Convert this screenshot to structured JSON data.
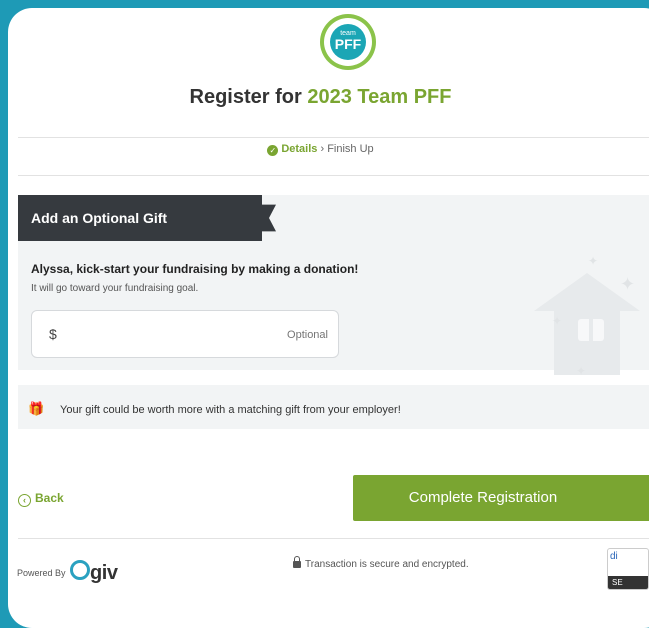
{
  "logo": {
    "small_text": "team",
    "big_text": "PFF"
  },
  "title": {
    "prefix": "Register for ",
    "event": "2023 Team PFF"
  },
  "steps": {
    "current": "Details",
    "separator": "›",
    "next": "Finish Up"
  },
  "gift": {
    "tab_label": "Add an Optional Gift",
    "headline": "Alyssa, kick-start your fundraising by making a donation!",
    "subline": "It will go toward your fundraising goal.",
    "currency": "$",
    "placeholder": "Optional"
  },
  "match": {
    "text": "Your gift could be worth more with a matching gift from your employer!"
  },
  "actions": {
    "back_label": "Back",
    "complete_label": "Complete Registration"
  },
  "footer": {
    "powered_by": "Powered By",
    "brand": "giv",
    "secure_text": "Transaction is secure and encrypted.",
    "badge_top": "di",
    "badge_bottom": "SE"
  },
  "colors": {
    "accent": "#7aa531",
    "background": "#1e9ab6",
    "dark_tab": "#363a3f",
    "brand_teal": "#1ba6b5"
  }
}
